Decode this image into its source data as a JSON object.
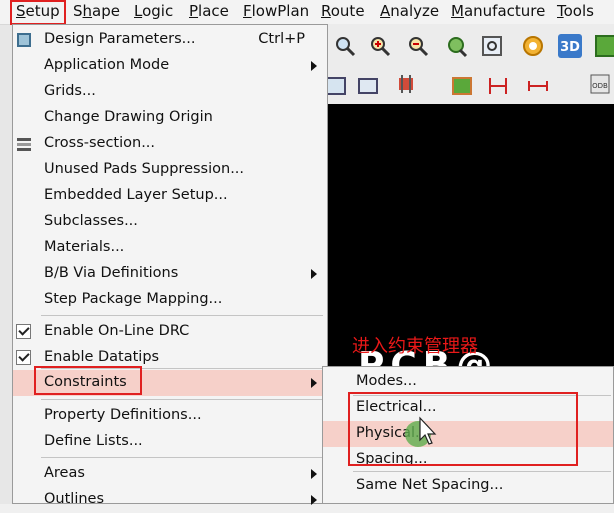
{
  "menubar": {
    "items": [
      {
        "label": "Setup",
        "key": "S",
        "rest": "etup"
      },
      {
        "label": "Shape",
        "key": "h",
        "pre": "S",
        "rest": "ape"
      },
      {
        "label": "Logic",
        "key": "L",
        "rest": "ogic"
      },
      {
        "label": "Place",
        "key": "P",
        "rest": "lace"
      },
      {
        "label": "FlowPlan",
        "key": "F",
        "rest": "lowPlan"
      },
      {
        "label": "Route",
        "key": "R",
        "rest": "oute"
      },
      {
        "label": "Analyze",
        "key": "A",
        "rest": "nalyze"
      },
      {
        "label": "Manufacture",
        "key": "M",
        "rest": "anufacture"
      },
      {
        "label": "Tools",
        "key": "T",
        "rest": "ools"
      }
    ]
  },
  "setup_menu": {
    "items": [
      {
        "label": "Design Parameters...",
        "shortcut": "Ctrl+P",
        "icon": "design-parameters-icon"
      },
      {
        "label": "Application Mode",
        "submenu": true
      },
      {
        "label": "Grids..."
      },
      {
        "label": "Change Drawing Origin"
      },
      {
        "label": "Cross-section...",
        "icon": "cross-section-icon"
      },
      {
        "label": "Unused Pads Suppression..."
      },
      {
        "label": "Embedded Layer Setup..."
      },
      {
        "label": "Subclasses..."
      },
      {
        "label": "Materials..."
      },
      {
        "label": "B/B Via Definitions",
        "submenu": true
      },
      {
        "label": "Step Package Mapping..."
      },
      {
        "label": "Enable On-Line DRC",
        "checked": true
      },
      {
        "label": "Enable Datatips",
        "checked": true
      },
      {
        "label": "Constraints",
        "submenu": true,
        "highlighted": true
      },
      {
        "label": "Property Definitions..."
      },
      {
        "label": "Define Lists..."
      },
      {
        "label": "Areas",
        "submenu": true
      },
      {
        "label": "Outlines",
        "submenu": true
      }
    ]
  },
  "constraints_submenu": {
    "items": [
      {
        "label": "Modes..."
      },
      {
        "label": "Electrical..."
      },
      {
        "label": "Physical...",
        "highlighted": true
      },
      {
        "label": "Spacing..."
      },
      {
        "label": "Same Net Spacing..."
      }
    ]
  },
  "annotation": {
    "text": "进入约束管理器"
  },
  "canvas_text": "PCB@ CCM",
  "colors": {
    "highlight": "#f6d0c9",
    "annotation_red": "#e02020",
    "canvas": "#000000",
    "menu_bg": "#f4f4f4"
  }
}
